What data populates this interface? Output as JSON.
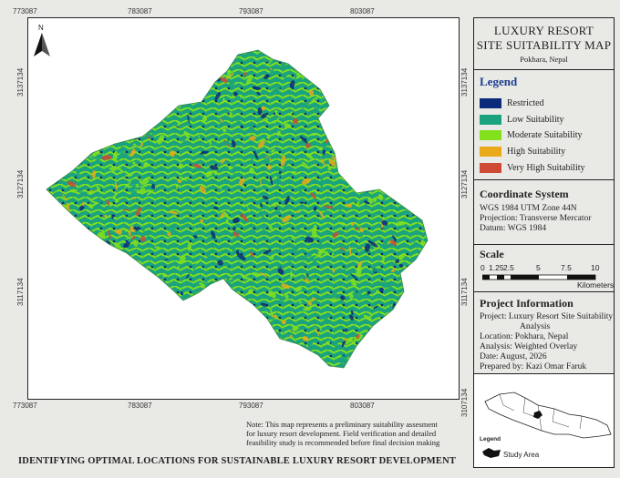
{
  "title": {
    "line1": "LUXURY RESORT",
    "line2": "SITE SUITABILITY MAP",
    "sub": "Pokhara, Nepal"
  },
  "legend": {
    "heading": "Legend",
    "items": [
      {
        "label": "Restricted",
        "color": "#0b2a7a"
      },
      {
        "label": "Low Suitability",
        "color": "#1aa37e"
      },
      {
        "label": "Moderate Suitability",
        "color": "#82e01c"
      },
      {
        "label": "High Suitability",
        "color": "#eaa918"
      },
      {
        "label": "Very High Suitability",
        "color": "#cf4a35"
      }
    ]
  },
  "coordinate_system": {
    "heading": "Coordinate System",
    "line1": "WGS 1984 UTM Zone 44N",
    "line2": "Projection: Transverse Mercator",
    "line3": "Datum: WGS 1984"
  },
  "scale": {
    "heading": "Scale",
    "labels": [
      "0",
      "1.25",
      "2.5",
      "5",
      "7.5",
      "10"
    ],
    "unit": "Kilometers"
  },
  "project": {
    "heading": "Project Information",
    "project_line1": "Project: Luxury Resort Site Suitability",
    "project_line2": "Analysis",
    "location": "Location: Pokhara, Nepal",
    "analysis": "Analysis: Weighted Overlay",
    "date": "Date: August, 2026",
    "prepared": "Prepared by: Kazi Omar Faruk"
  },
  "inset": {
    "legend_label": "Legend",
    "study_area": "Study Area"
  },
  "grid": {
    "top_x": [
      "773087",
      "783087",
      "793087",
      "803087"
    ],
    "bottom_x": [
      "773087",
      "783087",
      "793087",
      "803087"
    ],
    "left_y": [
      "3137134",
      "3127134",
      "3117134"
    ],
    "right_y": [
      "3137134",
      "3127134",
      "3117134",
      "3107134"
    ]
  },
  "north_label": "N",
  "note": {
    "line1": "Note: This map represents a preliminary suitability assesment",
    "line2": "for luxury resort development. Field verification and detailed",
    "line3": "feasibility study is recommended before final decision making"
  },
  "footer_title": "IDENTIFYING OPTIMAL LOCATIONS FOR SUSTAINABLE LUXURY RESORT DEVELOPMENT"
}
